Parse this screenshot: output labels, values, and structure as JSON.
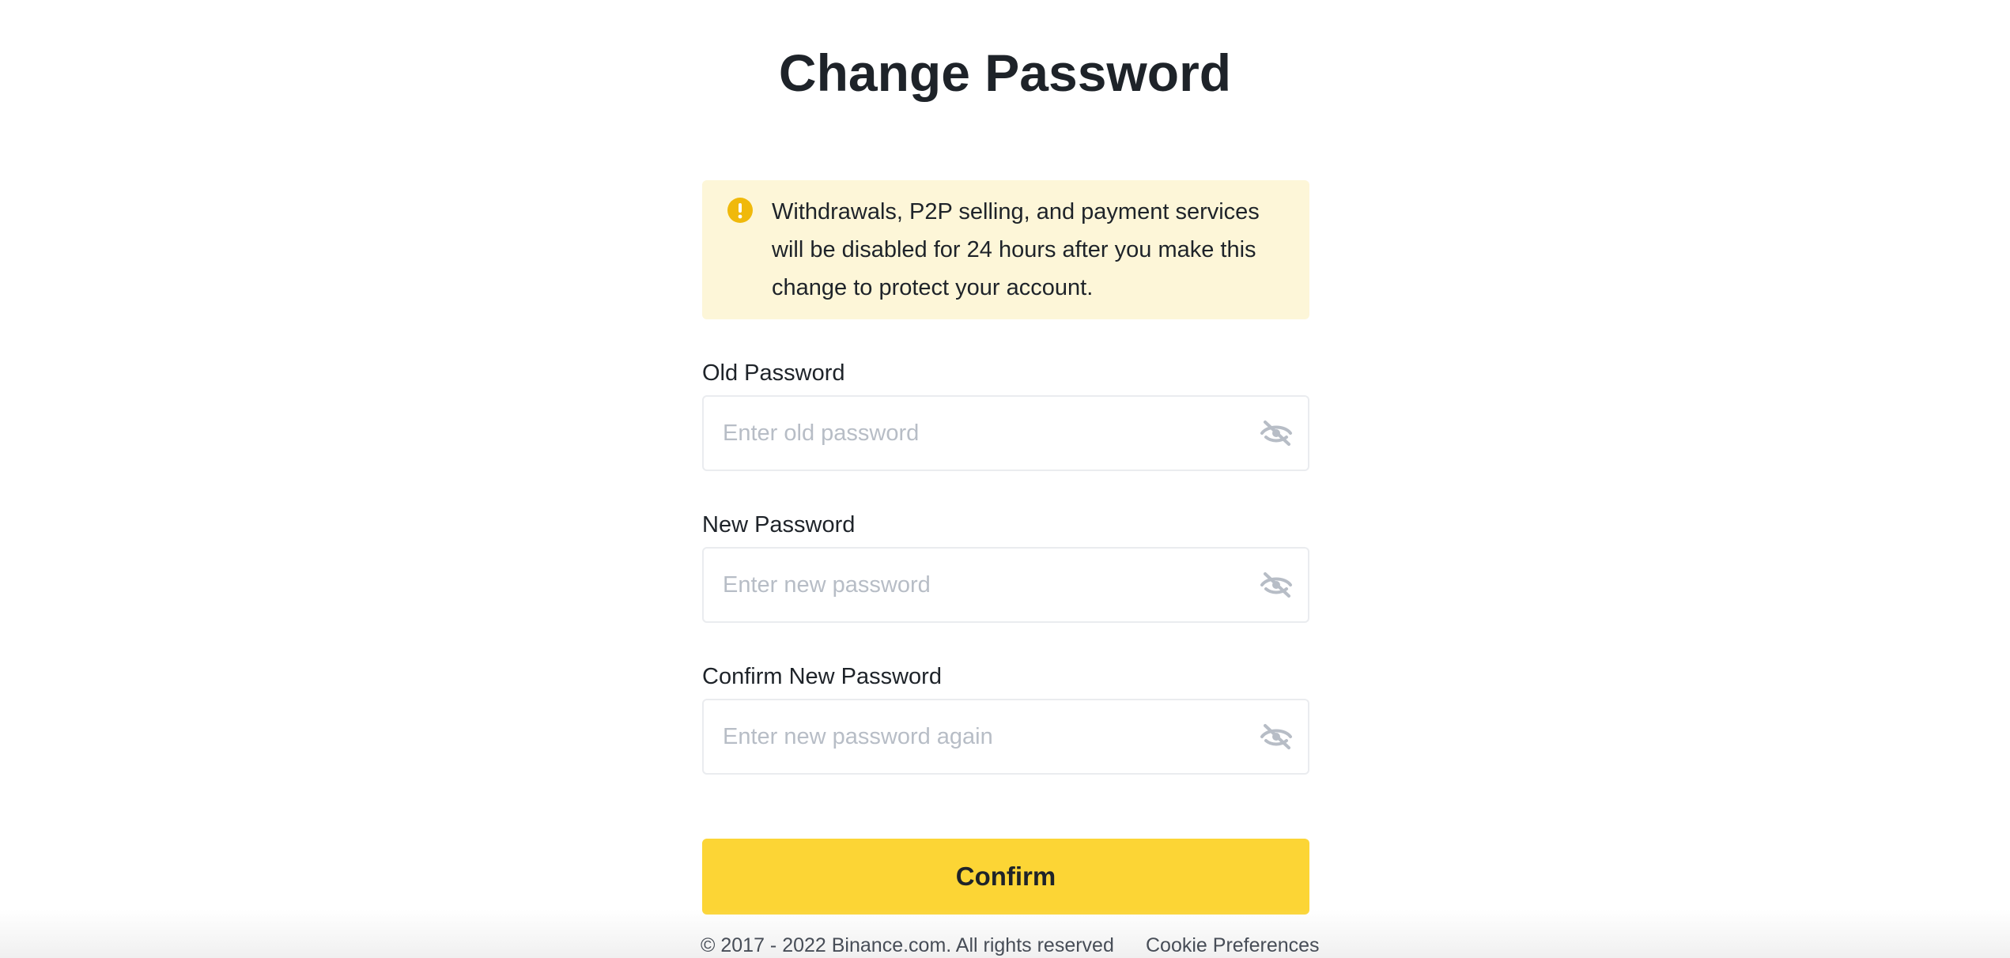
{
  "page": {
    "title": "Change Password"
  },
  "warning": {
    "icon": "exclamation-circle-icon",
    "icon_color": "#f0b90b",
    "background": "#fdf6d8",
    "text": "Withdrawals, P2P selling, and payment services will be disabled for 24 hours after you make this change to protect your account."
  },
  "fields": {
    "old": {
      "label": "Old Password",
      "placeholder": "Enter old password",
      "value": "",
      "toggle_icon": "eye-slash-icon"
    },
    "new": {
      "label": "New Password",
      "placeholder": "Enter new password",
      "value": "",
      "toggle_icon": "eye-slash-icon"
    },
    "confirm": {
      "label": "Confirm New Password",
      "placeholder": "Enter new password again",
      "value": "",
      "toggle_icon": "eye-slash-icon"
    }
  },
  "confirm_button": {
    "label": "Confirm",
    "color": "#fcd535"
  },
  "footer": {
    "copyright": "© 2017 - 2022 Binance.com. All rights reserved",
    "cookie_link": "Cookie Preferences"
  }
}
